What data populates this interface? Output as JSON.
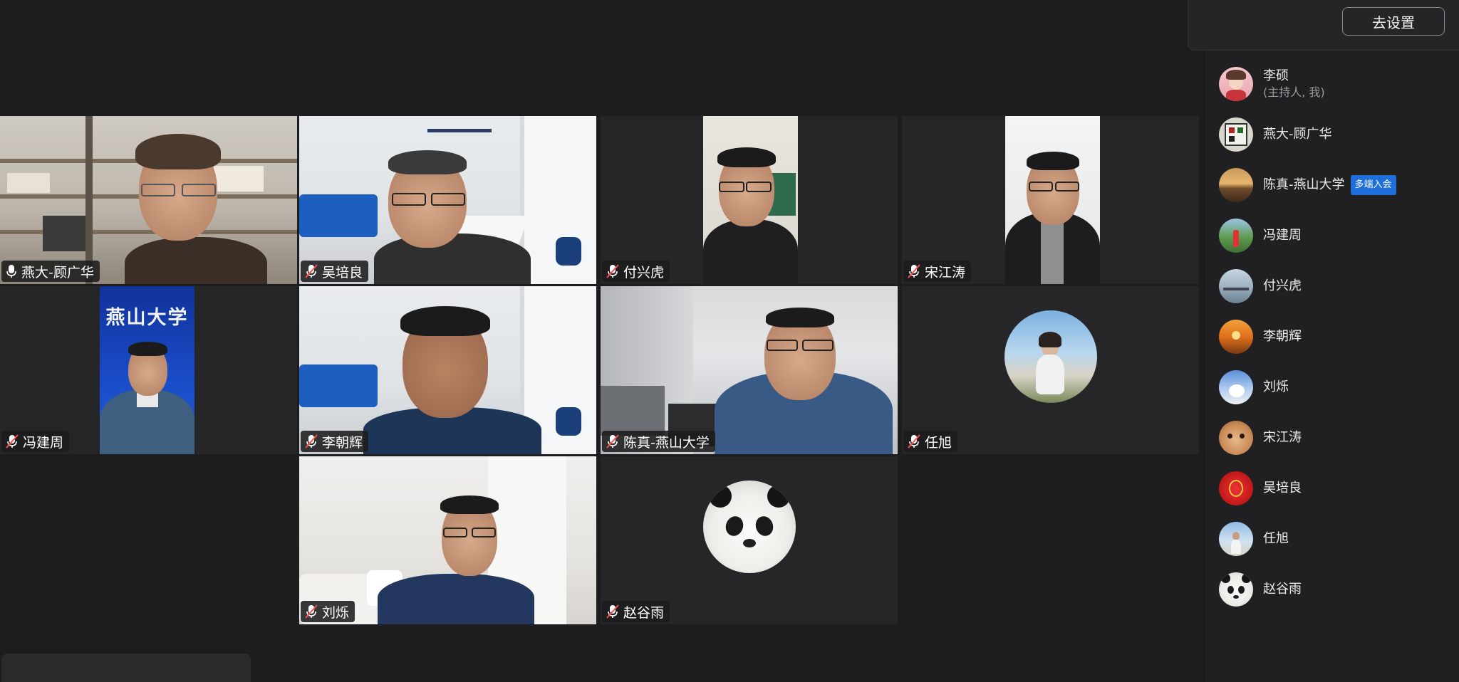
{
  "tiles": [
    {
      "name": "燕大-顾广华",
      "mic": "on"
    },
    {
      "name": "吴培良",
      "mic": "muted"
    },
    {
      "name": "付兴虎",
      "mic": "muted"
    },
    {
      "name": "宋江涛",
      "mic": "muted"
    },
    {
      "name": "冯建周",
      "mic": "muted"
    },
    {
      "name": "李朝辉",
      "mic": "muted"
    },
    {
      "name": "陈真-燕山大学",
      "mic": "muted"
    },
    {
      "name": "任旭",
      "mic": "muted"
    },
    {
      "name": "刘烁",
      "mic": "muted"
    },
    {
      "name": "赵谷雨",
      "mic": "muted"
    }
  ],
  "panel": {
    "settings_button": "去设置",
    "participants": [
      {
        "name": "李硕",
        "sub": "(主持人, 我)"
      },
      {
        "name": "燕大-顾广华"
      },
      {
        "name": "陈真-燕山大学",
        "badge": "多端入会"
      },
      {
        "name": "冯建周"
      },
      {
        "name": "付兴虎"
      },
      {
        "name": "李朝辉"
      },
      {
        "name": "刘烁"
      },
      {
        "name": "宋江涛"
      },
      {
        "name": "吴培良"
      },
      {
        "name": "任旭"
      },
      {
        "name": "赵谷雨"
      }
    ]
  },
  "banner_text": "燕山大学"
}
